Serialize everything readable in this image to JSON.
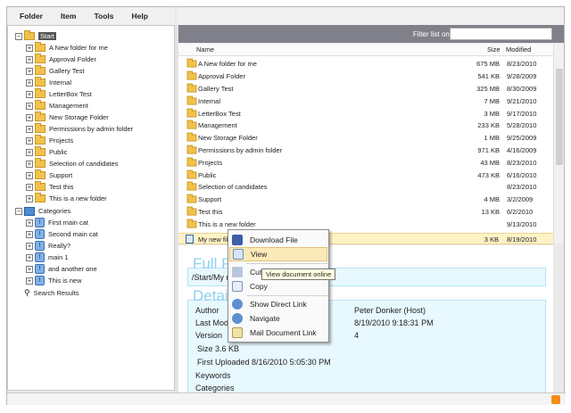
{
  "menu": [
    "Folder",
    "Item",
    "Tools",
    "Help"
  ],
  "filter": {
    "label": "Filter list on:",
    "value": ""
  },
  "tree": {
    "root": "Start",
    "folders": [
      "A New folder for me",
      "Approval Folder",
      "Gallery Test",
      "Internal",
      "LetterBox Test",
      "Management",
      "New Storage Folder",
      "Permissions by admin folder",
      "Projects",
      "Public",
      "Selection of candidates",
      "Support",
      "Test this",
      "This is a new folder"
    ],
    "categories_label": "Categories",
    "categories": [
      "First main cat",
      "Second main cat",
      "Really?",
      "main 1",
      "and another one",
      "This is new"
    ],
    "search": "Search Results"
  },
  "list": {
    "headers": {
      "name": "Name",
      "size": "Size",
      "modified": "Modified"
    },
    "rows": [
      {
        "name": "A New folder for me",
        "size": "675 MB",
        "modified": "8/23/2010"
      },
      {
        "name": "Approval Folder",
        "size": "541 KB",
        "modified": "9/28/2009"
      },
      {
        "name": "Gallery Test",
        "size": "325 MB",
        "modified": "8/30/2009"
      },
      {
        "name": "Internal",
        "size": "7 MB",
        "modified": "9/21/2010"
      },
      {
        "name": "LetterBox Test",
        "size": "3 MB",
        "modified": "9/17/2010"
      },
      {
        "name": "Management",
        "size": "233 KB",
        "modified": "5/28/2010"
      },
      {
        "name": "New Storage Folder",
        "size": "1 MB",
        "modified": "9/25/2009"
      },
      {
        "name": "Permissions by admin folder",
        "size": "971 KB",
        "modified": "4/16/2009"
      },
      {
        "name": "Projects",
        "size": "43 MB",
        "modified": "8/23/2010"
      },
      {
        "name": "Public",
        "size": "473 KB",
        "modified": "6/16/2010"
      },
      {
        "name": "Selection of candidates",
        "size": "",
        "modified": "8/23/2010"
      },
      {
        "name": "Support",
        "size": "4 MB",
        "modified": "3/2/2009"
      },
      {
        "name": "Test this",
        "size": "13 KB",
        "modified": "6/2/2010"
      },
      {
        "name": "This is a new folder",
        "size": "",
        "modified": "9/13/2010"
      }
    ],
    "file_row": {
      "name": "My new file",
      "size": "3 KB",
      "modified": "8/19/2010"
    }
  },
  "details": {
    "full_path_title": "Full P",
    "path_text": "/Start/My n",
    "details_title": "Detail",
    "author_label": "Author",
    "author_value": "Peter Donker (Host)",
    "last_modified_label": "Last Modifi",
    "last_modified_value": "8/19/2010 9:18:31 PM",
    "version_label": "Version",
    "version_value": "4",
    "size_text": "Size  3.6 KB",
    "first_uploaded_text": "First Uploaded  8/16/2010 5:05:30 PM",
    "keywords_label": "Keywords",
    "categories_label": "Categories"
  },
  "context_menu": {
    "download": "Download File",
    "view": "View",
    "cut": "Cut",
    "copy": "Copy",
    "show_link": "Show Direct Link",
    "navigate": "Navigate",
    "mail_link": "Mail Document Link"
  },
  "tooltip": "View document online",
  "colors": {
    "header_bar": "#80808a",
    "highlight_row": "#fff3c6",
    "title_blue": "#8fd0ef",
    "detail_bg": "#e7f8fe"
  }
}
